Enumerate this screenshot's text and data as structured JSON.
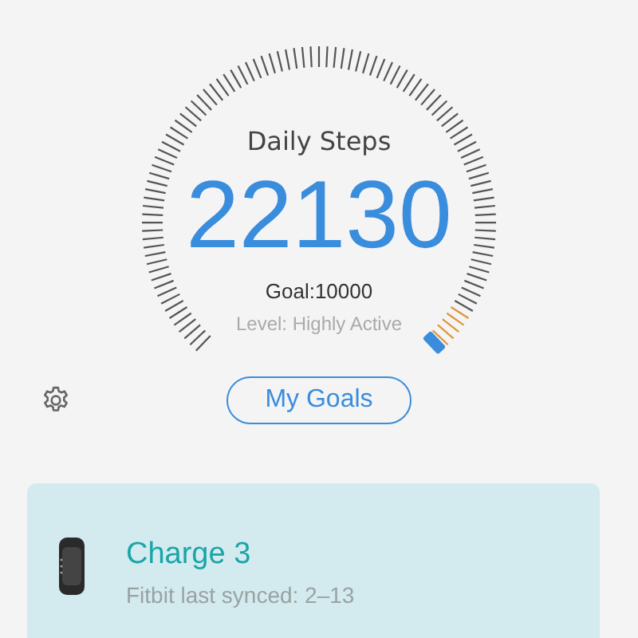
{
  "gauge": {
    "title": "Daily Steps",
    "value": "22130",
    "goal": "Goal:10000",
    "level_text": "Level: Highly Active"
  },
  "goals_button": "My Goals",
  "device": {
    "name": "Charge 3",
    "status": "Fitbit last synced: 2–13"
  }
}
